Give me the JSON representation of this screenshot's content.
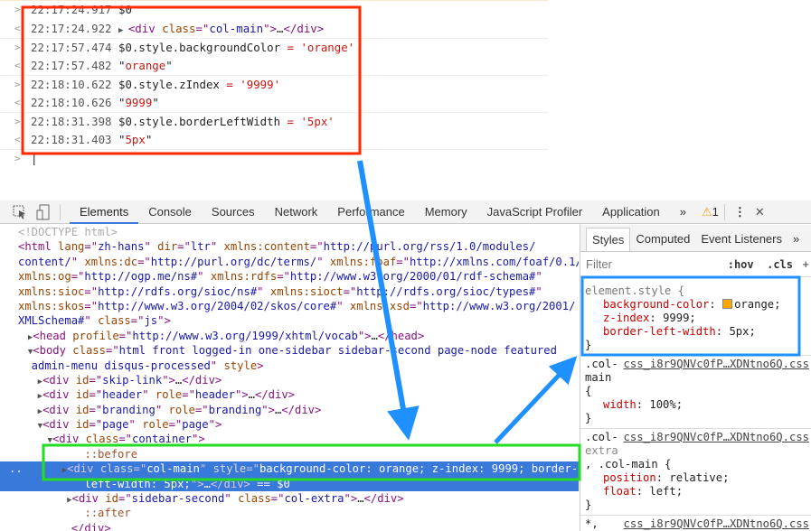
{
  "console": {
    "rows": [
      {
        "dir": ">",
        "ts": "22:17:24.917",
        "tokens": [
          [
            "",
            "$0"
          ]
        ]
      },
      {
        "dir": "<",
        "ts": "22:17:24.922",
        "tokens": [
          [
            "tri",
            "▶ "
          ],
          [
            "tag",
            "<div "
          ],
          [
            "attr",
            "class"
          ],
          [
            "tag",
            "=\""
          ],
          [
            "val",
            "col-main"
          ],
          [
            "tag",
            "\">"
          ],
          [
            "",
            "…"
          ],
          [
            "tag",
            "</div>"
          ]
        ]
      },
      {
        "dir": ">",
        "ts": "22:17:57.474",
        "tokens": [
          [
            "",
            "$0.style.backgroundColor "
          ],
          [
            "str",
            "="
          ],
          [
            "",
            " "
          ],
          [
            "str",
            "'orange'"
          ]
        ]
      },
      {
        "dir": "<",
        "ts": "22:17:57.482",
        "tokens": [
          [
            "",
            "\""
          ],
          [
            "str",
            "orange"
          ],
          [
            "",
            "\""
          ]
        ]
      },
      {
        "dir": ">",
        "ts": "22:18:10.622",
        "tokens": [
          [
            "",
            "$0.style.zIndex "
          ],
          [
            "str",
            "="
          ],
          [
            "",
            " "
          ],
          [
            "str",
            "'9999'"
          ]
        ]
      },
      {
        "dir": "<",
        "ts": "22:18:10.626",
        "tokens": [
          [
            "",
            "\""
          ],
          [
            "str",
            "9999"
          ],
          [
            "",
            "\""
          ]
        ]
      },
      {
        "dir": ">",
        "ts": "22:18:31.398",
        "tokens": [
          [
            "",
            "$0.style.borderLeftWidth "
          ],
          [
            "str",
            "="
          ],
          [
            "",
            " "
          ],
          [
            "str",
            "'5px'"
          ]
        ]
      },
      {
        "dir": "<",
        "ts": "22:18:31.403",
        "tokens": [
          [
            "",
            "\""
          ],
          [
            "str",
            "5px"
          ],
          [
            "",
            "\""
          ]
        ]
      }
    ],
    "prompt": ">"
  },
  "toolbar": {
    "tabs": [
      "Elements",
      "Console",
      "Sources",
      "Network",
      "Performance",
      "Memory",
      "JavaScript Profiler",
      "Application"
    ],
    "active_tab": "Elements",
    "more": "»",
    "warning_count": "1",
    "warning_icon": "⚠",
    "menu": "⋮",
    "close": "✕"
  },
  "elements": {
    "lines": [
      [
        [
          "cm",
          "<!DOCTYPE html>"
        ]
      ],
      [
        [
          "tag",
          "<html "
        ],
        [
          "attr",
          "lang"
        ],
        [
          "tag",
          "=\""
        ],
        [
          "val",
          "zh-hans"
        ],
        [
          "tag",
          "\" "
        ],
        [
          "attr",
          "dir"
        ],
        [
          "tag",
          "=\""
        ],
        [
          "val",
          "ltr"
        ],
        [
          "tag",
          "\" "
        ],
        [
          "attr",
          "xmlns:content"
        ],
        [
          "tag",
          "=\""
        ],
        [
          "val",
          "http://purl.org/rss/1.0/modules/"
        ]
      ],
      [
        [
          "val",
          "content/"
        ],
        [
          "tag",
          "\" "
        ],
        [
          "attr",
          "xmlns:dc"
        ],
        [
          "tag",
          "=\""
        ],
        [
          "val",
          "http://purl.org/dc/terms/"
        ],
        [
          "tag",
          "\" "
        ],
        [
          "attr",
          "xmlns:foaf"
        ],
        [
          "tag",
          "=\""
        ],
        [
          "val",
          "http://xmlns.com/foaf/0.1/"
        ],
        [
          "tag",
          "\""
        ]
      ],
      [
        [
          "attr",
          "xmlns:og"
        ],
        [
          "tag",
          "=\""
        ],
        [
          "val",
          "http://ogp.me/ns#"
        ],
        [
          "tag",
          "\" "
        ],
        [
          "attr",
          "xmlns:rdfs"
        ],
        [
          "tag",
          "=\""
        ],
        [
          "val",
          "http://www.w3.org/2000/01/rdf-schema#"
        ],
        [
          "tag",
          "\""
        ]
      ],
      [
        [
          "attr",
          "xmlns:sioc"
        ],
        [
          "tag",
          "=\""
        ],
        [
          "val",
          "http://rdfs.org/sioc/ns#"
        ],
        [
          "tag",
          "\" "
        ],
        [
          "attr",
          "xmlns:sioct"
        ],
        [
          "tag",
          "=\""
        ],
        [
          "val",
          "http://rdfs.org/sioc/types#"
        ],
        [
          "tag",
          "\""
        ]
      ],
      [
        [
          "attr",
          "xmlns:skos"
        ],
        [
          "tag",
          "=\""
        ],
        [
          "val",
          "http://www.w3.org/2004/02/skos/core#"
        ],
        [
          "tag",
          "\" "
        ],
        [
          "attr",
          "xmlns:xsd"
        ],
        [
          "tag",
          "=\""
        ],
        [
          "val",
          "http://www.w3.org/2001/"
        ]
      ],
      [
        [
          "val",
          "XMLSchema#"
        ],
        [
          "tag",
          "\" "
        ],
        [
          "attr",
          "class"
        ],
        [
          "tag",
          "=\""
        ],
        [
          "val",
          "js"
        ],
        [
          "tag",
          "\">"
        ]
      ],
      [
        [
          "tri",
          "  ▶"
        ],
        [
          "tag",
          "<head "
        ],
        [
          "attr",
          "profile"
        ],
        [
          "tag",
          "=\""
        ],
        [
          "val",
          "http://www.w3.org/1999/xhtml/vocab"
        ],
        [
          "tag",
          "\">"
        ],
        [
          "",
          "…"
        ],
        [
          "tag",
          "</head>"
        ]
      ],
      [
        [
          "tri",
          "  ▼"
        ],
        [
          "tag",
          "<body "
        ],
        [
          "attr",
          "class"
        ],
        [
          "tag",
          "=\""
        ],
        [
          "val",
          "html front logged-in one-sidebar sidebar-second page-node featured"
        ]
      ],
      [
        [
          "val",
          "  admin-menu disqus-processed"
        ],
        [
          "tag",
          "\" "
        ],
        [
          "attr",
          "style"
        ],
        [
          "tag",
          ">"
        ]
      ],
      [
        [
          "tri",
          "    ▶"
        ],
        [
          "tag",
          "<div "
        ],
        [
          "attr",
          "id"
        ],
        [
          "tag",
          "=\""
        ],
        [
          "val",
          "skip-link"
        ],
        [
          "tag",
          "\">"
        ],
        [
          "",
          "…"
        ],
        [
          "tag",
          "</div>"
        ]
      ],
      [
        [
          "tri",
          "    ▶"
        ],
        [
          "tag",
          "<div "
        ],
        [
          "attr",
          "id"
        ],
        [
          "tag",
          "=\""
        ],
        [
          "val",
          "header"
        ],
        [
          "tag",
          "\" "
        ],
        [
          "attr",
          "role"
        ],
        [
          "tag",
          "=\""
        ],
        [
          "val",
          "header"
        ],
        [
          "tag",
          "\">"
        ],
        [
          "",
          "…"
        ],
        [
          "tag",
          "</div>"
        ]
      ],
      [
        [
          "tri",
          "    ▶"
        ],
        [
          "tag",
          "<div "
        ],
        [
          "attr",
          "id"
        ],
        [
          "tag",
          "=\""
        ],
        [
          "val",
          "branding"
        ],
        [
          "tag",
          "\" "
        ],
        [
          "attr",
          "role"
        ],
        [
          "tag",
          "=\""
        ],
        [
          "val",
          "branding"
        ],
        [
          "tag",
          "\">"
        ],
        [
          "",
          "…"
        ],
        [
          "tag",
          "</div>"
        ]
      ],
      [
        [
          "tri",
          "    ▼"
        ],
        [
          "tag",
          "<div "
        ],
        [
          "attr",
          "id"
        ],
        [
          "tag",
          "=\""
        ],
        [
          "val",
          "page"
        ],
        [
          "tag",
          "\" "
        ],
        [
          "attr",
          "role"
        ],
        [
          "tag",
          "=\""
        ],
        [
          "val",
          "page"
        ],
        [
          "tag",
          "\">"
        ]
      ],
      [
        [
          "tri",
          "      ▼"
        ],
        [
          "tag",
          "<div "
        ],
        [
          "attr",
          "class"
        ],
        [
          "tag",
          "=\""
        ],
        [
          "val",
          "container"
        ],
        [
          "tag",
          "\">"
        ]
      ],
      [
        [
          "pse",
          "          ::before"
        ]
      ],
      [
        [
          "",
          "..      "
        ],
        [
          "tri",
          "▶"
        ],
        [
          "tag",
          "<div "
        ],
        [
          "attr",
          "class"
        ],
        [
          "tag",
          "=\""
        ],
        [
          "val",
          "col-main"
        ],
        [
          "tag",
          "\" "
        ],
        [
          "attr",
          "style"
        ],
        [
          "tag",
          "=\""
        ],
        [
          "val",
          "background-color: orange; z-index: 9999; border-"
        ]
      ],
      [
        [
          "val",
          "          left-width: 5px;"
        ],
        [
          "tag",
          "\">"
        ],
        [
          "",
          "…"
        ],
        [
          "tag",
          "</div>"
        ],
        [
          "cm",
          " == $0"
        ]
      ],
      [
        [
          "tri",
          "          ▶"
        ],
        [
          "tag",
          "<div "
        ],
        [
          "attr",
          "id"
        ],
        [
          "tag",
          "=\""
        ],
        [
          "val",
          "sidebar-second"
        ],
        [
          "tag",
          "\" "
        ],
        [
          "attr",
          "class"
        ],
        [
          "tag",
          "=\""
        ],
        [
          "val",
          "col-extra"
        ],
        [
          "tag",
          "\">"
        ],
        [
          "",
          "…"
        ],
        [
          "tag",
          "</div>"
        ]
      ],
      [
        [
          "pse",
          "          ::after"
        ]
      ],
      [
        [
          "tag",
          "        </div>"
        ]
      ],
      [
        [
          "tag",
          "      </div>"
        ]
      ]
    ],
    "selected_lines": [
      16,
      17
    ]
  },
  "styles": {
    "tabs": [
      "Styles",
      "Computed",
      "Event Listeners"
    ],
    "more": "»",
    "filter_placeholder": "Filter",
    "hov": ":hov",
    "cls": ".cls",
    "plus": "+",
    "element_style": {
      "selector": "element.style {",
      "props": [
        {
          "name": "background-color",
          "value": "orange;",
          "swatch": "#ffa500"
        },
        {
          "name": "z-index",
          "value": "9999;"
        },
        {
          "name": "border-left-width",
          "value": "5px;"
        }
      ]
    },
    "rule2": {
      "selector1": ".col-",
      "selector2": "main",
      "selector3": "{",
      "source": "css_i8r9QNVc0fP…XDNtno6Q.css",
      "props": [
        {
          "name": "width",
          "value": "100%;"
        }
      ]
    },
    "rule3": {
      "selector1": ".col-",
      "selector2": "extra",
      "selector3": ", .col-main {",
      "source": "css_i8r9QNVc0fP…XDNtno6Q.css",
      "props": [
        {
          "name": "position",
          "value": "relative;"
        },
        {
          "name": "float",
          "value": "left;"
        }
      ]
    },
    "rule4": {
      "selector1": "*,",
      "source": "css_i8r9QNVc0fP…XDNtno6Q.css"
    },
    "close_brace": "}"
  },
  "colors": {
    "annotation_red": "#ff2a00",
    "annotation_green": "#22dd22",
    "annotation_blue": "#1e90ff",
    "selection": "#3879d9"
  }
}
